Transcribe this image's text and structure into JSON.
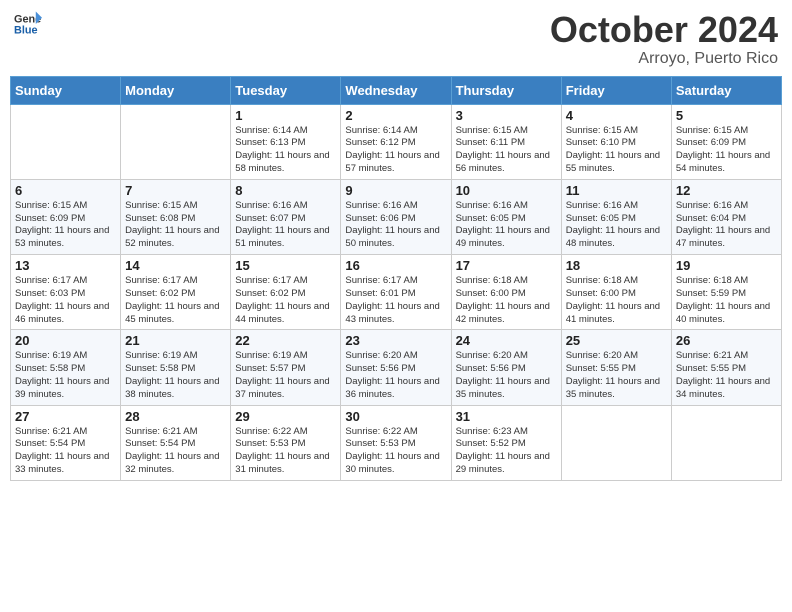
{
  "logo": {
    "line1": "General",
    "line2": "Blue"
  },
  "title": "October 2024",
  "subtitle": "Arroyo, Puerto Rico",
  "days_header": [
    "Sunday",
    "Monday",
    "Tuesday",
    "Wednesday",
    "Thursday",
    "Friday",
    "Saturday"
  ],
  "weeks": [
    [
      {
        "day": "",
        "info": ""
      },
      {
        "day": "",
        "info": ""
      },
      {
        "day": "1",
        "info": "Sunrise: 6:14 AM\nSunset: 6:13 PM\nDaylight: 11 hours and 58 minutes."
      },
      {
        "day": "2",
        "info": "Sunrise: 6:14 AM\nSunset: 6:12 PM\nDaylight: 11 hours and 57 minutes."
      },
      {
        "day": "3",
        "info": "Sunrise: 6:15 AM\nSunset: 6:11 PM\nDaylight: 11 hours and 56 minutes."
      },
      {
        "day": "4",
        "info": "Sunrise: 6:15 AM\nSunset: 6:10 PM\nDaylight: 11 hours and 55 minutes."
      },
      {
        "day": "5",
        "info": "Sunrise: 6:15 AM\nSunset: 6:09 PM\nDaylight: 11 hours and 54 minutes."
      }
    ],
    [
      {
        "day": "6",
        "info": "Sunrise: 6:15 AM\nSunset: 6:09 PM\nDaylight: 11 hours and 53 minutes."
      },
      {
        "day": "7",
        "info": "Sunrise: 6:15 AM\nSunset: 6:08 PM\nDaylight: 11 hours and 52 minutes."
      },
      {
        "day": "8",
        "info": "Sunrise: 6:16 AM\nSunset: 6:07 PM\nDaylight: 11 hours and 51 minutes."
      },
      {
        "day": "9",
        "info": "Sunrise: 6:16 AM\nSunset: 6:06 PM\nDaylight: 11 hours and 50 minutes."
      },
      {
        "day": "10",
        "info": "Sunrise: 6:16 AM\nSunset: 6:05 PM\nDaylight: 11 hours and 49 minutes."
      },
      {
        "day": "11",
        "info": "Sunrise: 6:16 AM\nSunset: 6:05 PM\nDaylight: 11 hours and 48 minutes."
      },
      {
        "day": "12",
        "info": "Sunrise: 6:16 AM\nSunset: 6:04 PM\nDaylight: 11 hours and 47 minutes."
      }
    ],
    [
      {
        "day": "13",
        "info": "Sunrise: 6:17 AM\nSunset: 6:03 PM\nDaylight: 11 hours and 46 minutes."
      },
      {
        "day": "14",
        "info": "Sunrise: 6:17 AM\nSunset: 6:02 PM\nDaylight: 11 hours and 45 minutes."
      },
      {
        "day": "15",
        "info": "Sunrise: 6:17 AM\nSunset: 6:02 PM\nDaylight: 11 hours and 44 minutes."
      },
      {
        "day": "16",
        "info": "Sunrise: 6:17 AM\nSunset: 6:01 PM\nDaylight: 11 hours and 43 minutes."
      },
      {
        "day": "17",
        "info": "Sunrise: 6:18 AM\nSunset: 6:00 PM\nDaylight: 11 hours and 42 minutes."
      },
      {
        "day": "18",
        "info": "Sunrise: 6:18 AM\nSunset: 6:00 PM\nDaylight: 11 hours and 41 minutes."
      },
      {
        "day": "19",
        "info": "Sunrise: 6:18 AM\nSunset: 5:59 PM\nDaylight: 11 hours and 40 minutes."
      }
    ],
    [
      {
        "day": "20",
        "info": "Sunrise: 6:19 AM\nSunset: 5:58 PM\nDaylight: 11 hours and 39 minutes."
      },
      {
        "day": "21",
        "info": "Sunrise: 6:19 AM\nSunset: 5:58 PM\nDaylight: 11 hours and 38 minutes."
      },
      {
        "day": "22",
        "info": "Sunrise: 6:19 AM\nSunset: 5:57 PM\nDaylight: 11 hours and 37 minutes."
      },
      {
        "day": "23",
        "info": "Sunrise: 6:20 AM\nSunset: 5:56 PM\nDaylight: 11 hours and 36 minutes."
      },
      {
        "day": "24",
        "info": "Sunrise: 6:20 AM\nSunset: 5:56 PM\nDaylight: 11 hours and 35 minutes."
      },
      {
        "day": "25",
        "info": "Sunrise: 6:20 AM\nSunset: 5:55 PM\nDaylight: 11 hours and 35 minutes."
      },
      {
        "day": "26",
        "info": "Sunrise: 6:21 AM\nSunset: 5:55 PM\nDaylight: 11 hours and 34 minutes."
      }
    ],
    [
      {
        "day": "27",
        "info": "Sunrise: 6:21 AM\nSunset: 5:54 PM\nDaylight: 11 hours and 33 minutes."
      },
      {
        "day": "28",
        "info": "Sunrise: 6:21 AM\nSunset: 5:54 PM\nDaylight: 11 hours and 32 minutes."
      },
      {
        "day": "29",
        "info": "Sunrise: 6:22 AM\nSunset: 5:53 PM\nDaylight: 11 hours and 31 minutes."
      },
      {
        "day": "30",
        "info": "Sunrise: 6:22 AM\nSunset: 5:53 PM\nDaylight: 11 hours and 30 minutes."
      },
      {
        "day": "31",
        "info": "Sunrise: 6:23 AM\nSunset: 5:52 PM\nDaylight: 11 hours and 29 minutes."
      },
      {
        "day": "",
        "info": ""
      },
      {
        "day": "",
        "info": ""
      }
    ]
  ]
}
